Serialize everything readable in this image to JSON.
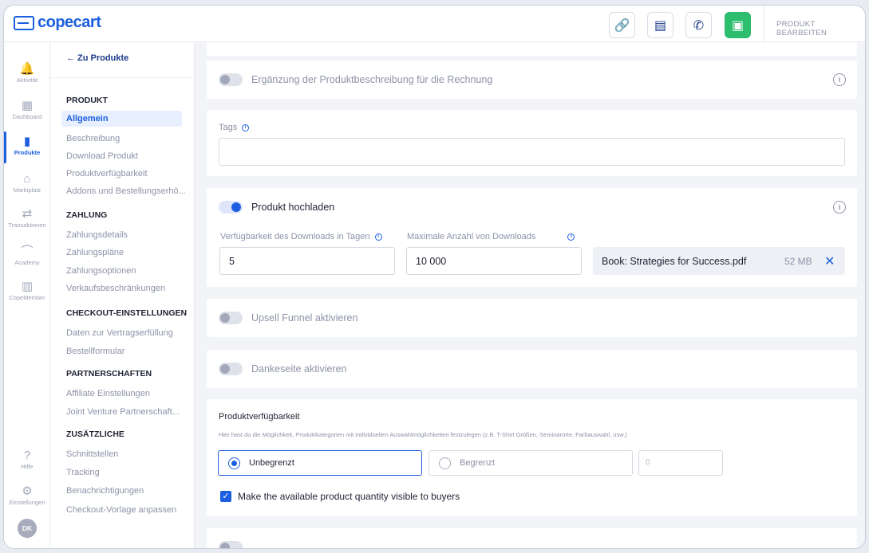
{
  "brand": {
    "name": "copecart",
    "color": "#1b5fe0"
  },
  "topbar": {
    "buttons": [
      {
        "icon": "link-icon",
        "glyph": "🔗"
      },
      {
        "icon": "document-icon",
        "glyph": "▤"
      },
      {
        "icon": "phone-icon",
        "glyph": "✆"
      },
      {
        "icon": "save-icon",
        "glyph": "▣"
      }
    ],
    "page_label": "PRODUKT BEARBEITEN"
  },
  "rail": {
    "items": [
      {
        "label": "Aktivität",
        "glyph": "🔔"
      },
      {
        "label": "Dashboard",
        "glyph": "▦"
      },
      {
        "label": "Produkte",
        "glyph": "▮",
        "active": true
      },
      {
        "label": "Marktplatz",
        "glyph": "⌂"
      },
      {
        "label": "Transaktionen",
        "glyph": "⇄"
      },
      {
        "label": "Academy",
        "glyph": "⌒"
      },
      {
        "label": "CopeMember",
        "glyph": "▥"
      },
      {
        "label": "Hilfe",
        "glyph": "?"
      },
      {
        "label": "Einstellungen",
        "glyph": "⚙"
      }
    ],
    "avatar": "DK"
  },
  "subnav": {
    "back": "← Zu Produkte",
    "sections": [
      {
        "title": "PRODUKT",
        "items": [
          "Allgemein",
          "Beschreibung",
          "Download Produkt",
          "Produktverfügbarkeit",
          "Addons und Bestellungserhö..."
        ]
      },
      {
        "title": "ZAHLUNG",
        "items": [
          "Zahlungsdetails",
          "Zahlungspläne",
          "Zahlungsoptionen",
          "Verkaufsbeschränkungen"
        ]
      },
      {
        "title": "CHECKOUT-EINSTELLUNGEN",
        "items": [
          "Daten zur Vertragserfüllung",
          "Bestellformular"
        ]
      },
      {
        "title": "PARTNERSCHAFTEN",
        "items": [
          "Affiliate Einstellungen",
          "Joint Venture Partnerschaft..."
        ]
      },
      {
        "title": "ZUSÄTZLICHE",
        "items": [
          "Schnittstellen",
          "Tracking",
          "Benachrichtigungen",
          "Checkout-Vorlage anpassen"
        ]
      }
    ]
  },
  "main": {
    "invoice_toggle": {
      "label": "Ergänzung der Produktbeschreibung für die Rechnung",
      "on": false
    },
    "tags": {
      "label": "Tags",
      "value": ""
    },
    "upload": {
      "toggle_label": "Produkt hochladen",
      "on": true,
      "days_label": "Verfügbarkeit des Downloads in Tagen",
      "days_value": "5",
      "max_label": "Maximale Anzahl von Downloads",
      "max_value": "10 000",
      "file_name": "Book: Strategies for Success.pdf",
      "file_size": "52 MB"
    },
    "upsell_toggle": {
      "label": "Upsell Funnel aktivieren",
      "on": false
    },
    "thanks_toggle": {
      "label": "Dankeseite aktivieren",
      "on": false
    },
    "availability": {
      "title": "Produktverfügbarkeit",
      "description": "Hier hast du die Möglichkeit, Produktkategorien mit individuellen Auswahlmöglichkeiten festzulegen (z.B. T-Shirt Größen, Seminarorte, Farbauswahl, usw.)",
      "option_unlimited": "Unbegrenzt",
      "option_limited": "Begrenzt",
      "limit_placeholder": "0",
      "selected": "Unbegrenzt",
      "checkbox_label": "Make the available product quantity visible to buyers",
      "checkbox_checked": true
    }
  }
}
